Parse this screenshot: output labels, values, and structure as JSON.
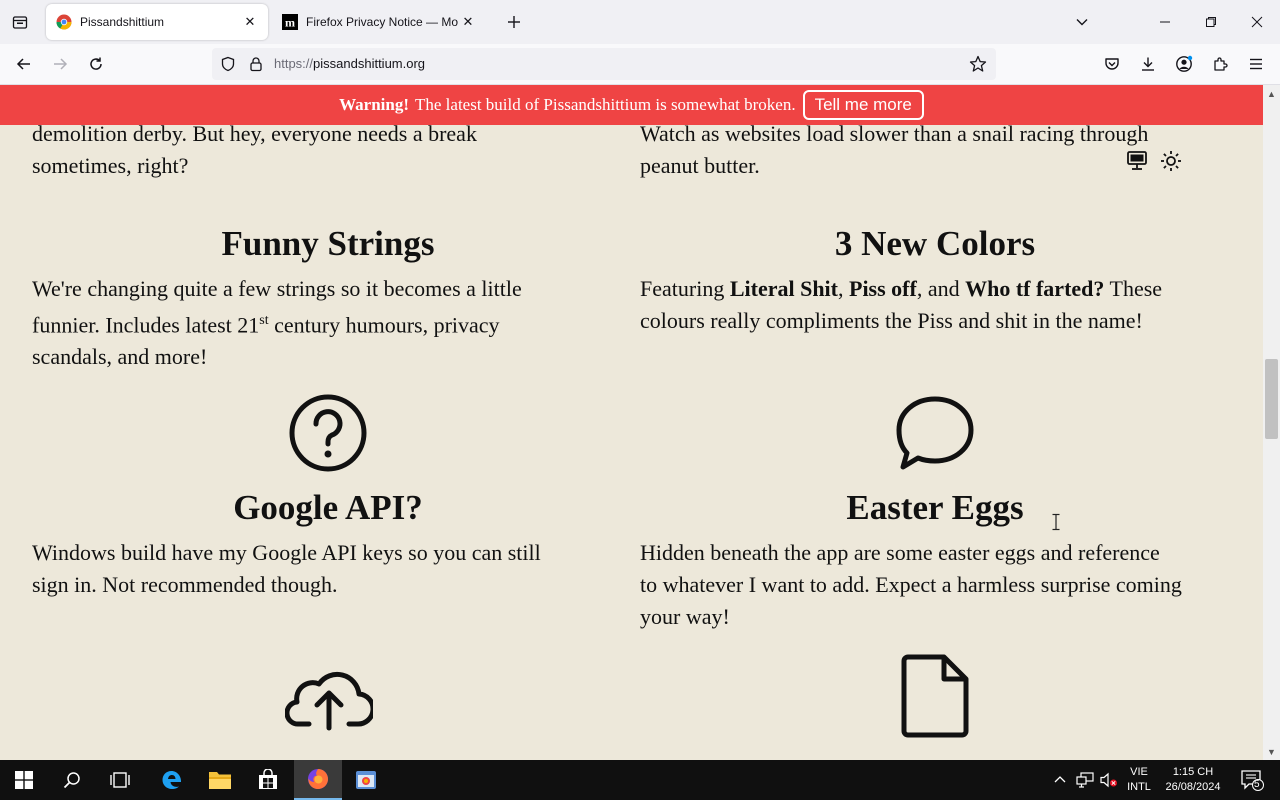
{
  "tabs": [
    {
      "title": "Pissandshittium",
      "icon": "chrome-style-icon",
      "active": true
    },
    {
      "title": "Firefox Privacy Notice — Mozilla",
      "icon": "mozilla-m-icon",
      "active": false
    }
  ],
  "url": {
    "protocol": "https://",
    "host": "pissandshittium.org"
  },
  "banner": {
    "warning_label": "Warning!",
    "message": "The latest build of Pissandshittium is somewhat broken.",
    "button_label": "Tell me more"
  },
  "content": {
    "left_top_text": [
      "demolition derby. But hey, everyone needs a break",
      "sometimes, right?"
    ],
    "right_top_text": [
      "Watch as websites load slower than a snail racing through",
      "peanut butter."
    ],
    "funny_strings": {
      "title": "Funny Strings",
      "line1": "We're changing quite a few strings so it becomes a little",
      "line2_pre": "funnier. Includes latest 21",
      "line2_sup": "st",
      "line2_post": " century humours, privacy",
      "line3": "scandals, and more!"
    },
    "new_colors": {
      "title": "3 New Colors",
      "featuring": "Featuring ",
      "color1": "Literal Shit",
      "sep1": ", ",
      "color2": "Piss off",
      "sep2": ", and ",
      "color3": "Who tf farted?",
      "after": " These",
      "line2": "colours really compliments the Piss and shit in the name!"
    },
    "google_api": {
      "title": "Google API?",
      "line1": "Windows build have my Google API keys so you can still",
      "line2": "sign in. Not recommended though."
    },
    "easter_eggs": {
      "title": "Easter Eggs",
      "line1": "Hidden beneath the app are some easter eggs and reference",
      "line2": "to whatever I want to add. Expect a harmless surprise coming",
      "line3": "your way!"
    }
  },
  "taskbar": {
    "lang_top": "VIE",
    "lang_bottom": "INTL",
    "time": "1:15 CH",
    "date": "26/08/2024",
    "notification_count": "5"
  },
  "colors": {
    "banner": "#ef4444",
    "page_bg": "#ede8da",
    "text": "#111111"
  }
}
